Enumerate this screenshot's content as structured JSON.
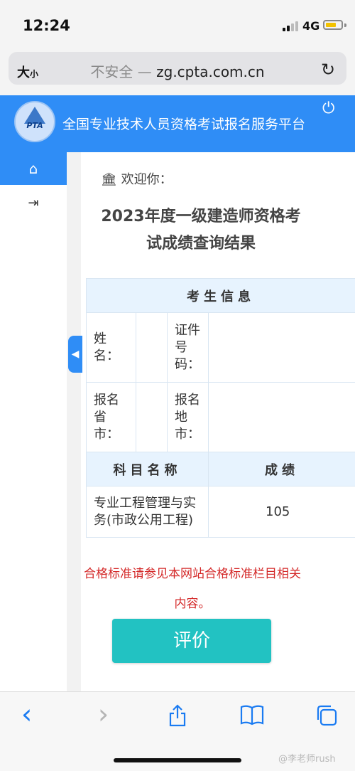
{
  "status": {
    "time": "12:24",
    "network": "4G"
  },
  "browser": {
    "text_size_big": "大",
    "text_size_small": "小",
    "insecure_label": "不安全 —",
    "url": "zg.cpta.com.cn",
    "reload_icon": "↻"
  },
  "header": {
    "logo_text": "PTA",
    "site_title": "全国专业技术人员资格考试报名服务平台",
    "power_icon": "⏻"
  },
  "sidebar": {
    "home_icon": "⌂",
    "login_icon": "⇥",
    "collapse_icon": "◀"
  },
  "main": {
    "welcome": "欢迎你：",
    "title_line1": "2023年度一级建造师资格考",
    "title_line2": "试成绩查询结果"
  },
  "table": {
    "section_header": "考生信息",
    "name_label": "姓名：",
    "id_label": "证件号码：",
    "province_label": "报名省市：",
    "city_label": "报名地市：",
    "subject_header": "科目名称",
    "score_header": "成绩",
    "rows": [
      {
        "subject": "专业工程管理与实务(市政公用工程)",
        "score": "105"
      }
    ]
  },
  "notice": "合格标准请参见本网站合格标准栏目相关内容。",
  "button": {
    "rate": "评价"
  },
  "toolbar": {
    "back": "‹",
    "forward": "›"
  },
  "watermark": "@李老师rush",
  "colors": {
    "brand_blue": "#2f8df6",
    "button_teal": "#22c2c2",
    "notice_red": "#d42a2a",
    "table_header": "#e7f3fe"
  }
}
